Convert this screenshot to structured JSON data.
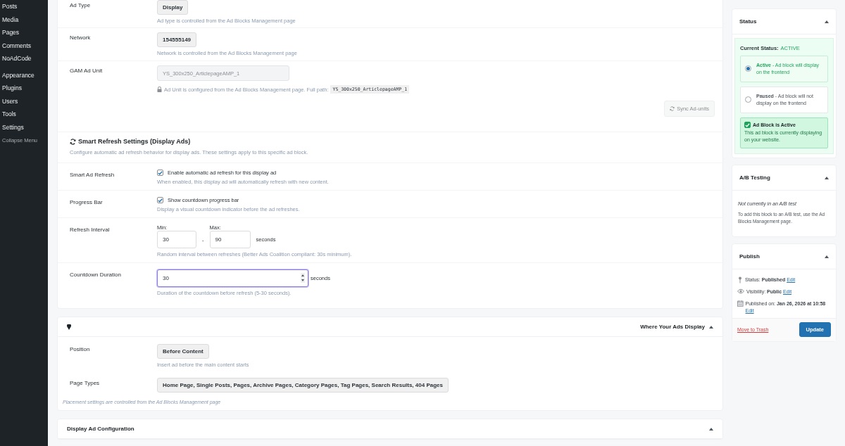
{
  "sidebar": {
    "groups": [
      {
        "items": [
          {
            "label": "Posts"
          },
          {
            "label": "Media"
          },
          {
            "label": "Pages"
          },
          {
            "label": "Comments"
          },
          {
            "label": "NoAdCode"
          }
        ]
      },
      {
        "items": [
          {
            "label": "Appearance"
          },
          {
            "label": "Plugins"
          },
          {
            "label": "Users"
          },
          {
            "label": "Tools"
          },
          {
            "label": "Settings"
          }
        ]
      }
    ],
    "collapse": "Collapse Menu"
  },
  "ad_settings": {
    "rows": [
      {
        "kind": "chip",
        "label": "Ad Type",
        "value": "Display",
        "help": "Ad type is controlled from the Ad Blocks Management page"
      },
      {
        "kind": "chip",
        "label": "Network",
        "value": "154555149",
        "help": "Network is controlled from the Ad Blocks Management page"
      },
      {
        "kind": "locked_input",
        "label": "GAM Ad Unit",
        "value": "YS_300x250_ArticlepageAMP_1",
        "help": "Ad Unit is configured from the Ad Blocks Management page. Full path:",
        "code": "YS_300x250_ArticlepageAMP_1"
      }
    ],
    "sync_button": {
      "label": "Sync Ad-units",
      "disabled": true
    }
  },
  "smart_refresh": {
    "title": "Smart Refresh Settings (Display Ads)",
    "description": "Configure automatic ad refresh behavior for display ads. These settings apply to this specific ad block.",
    "rows": [
      {
        "kind": "checkbox",
        "label": "Smart Ad Refresh",
        "option": "Enable automatic ad refresh for this display ad",
        "checked": true,
        "help": "When enabled, this display ad will automatically refresh with new content."
      },
      {
        "kind": "checkbox",
        "label": "Progress Bar",
        "option": "Show countdown progress bar",
        "checked": true,
        "help": "Display a visual countdown indicator before the ad refreshes."
      },
      {
        "kind": "interval",
        "label": "Refresh Interval",
        "min_label": "Min:",
        "min_value": "30",
        "separator": "-",
        "max_label": "Max:",
        "max_value": "90",
        "unit": "seconds",
        "help": "Random interval between refreshes (Better Ads Coalition compliant: 30s minimum)."
      },
      {
        "kind": "number",
        "label": "Countdown Duration",
        "value": "30",
        "focused": true,
        "unit": "seconds",
        "help": "Duration of the countdown before refresh (5-30 seconds)."
      }
    ]
  },
  "placement": {
    "title": "Where Your Ads Display",
    "expanded": true,
    "rows": [
      {
        "label": "Position",
        "value": "Before Content",
        "help": "Insert ad before the main content starts"
      },
      {
        "label": "Page Types",
        "value": "Home Page, Single Posts, Pages, Archive Pages, Category Pages, Tag Pages, Search Results, 404 Pages"
      }
    ],
    "note": "Placement settings are controlled from the Ad Blocks Management page"
  },
  "display_config": {
    "title": "Display Ad Configuration",
    "expanded": true
  },
  "status_box": {
    "title": "Status",
    "expanded": true,
    "current_label": "Current Status:",
    "current_value": "ACTIVE",
    "options": [
      {
        "title": "Active",
        "description": "- Ad block will display on the frontend",
        "selected": true
      },
      {
        "title": "Paused",
        "description": "- Ad block will not display on the frontend",
        "selected": false
      }
    ],
    "notice": {
      "title": "Ad Block is Active",
      "text": "This ad block is currently displaying on your website.",
      "checked": true
    }
  },
  "ab_testing": {
    "title": "A/B Testing",
    "expanded": true,
    "status": "Not currently in an A/B test",
    "help": "To add this block to an A/B test, use the Ad Blocks Management page."
  },
  "publish": {
    "title": "Publish",
    "expanded": true,
    "items": [
      {
        "kind": "status",
        "label": "Status:",
        "value": "Published",
        "link": "Edit"
      },
      {
        "kind": "visibility",
        "label": "Visibility:",
        "value": "Public",
        "link": "Edit"
      },
      {
        "kind": "date",
        "label": "Published on:",
        "value": "Jan 26, 2026 at 10:58",
        "link": "Edit"
      }
    ],
    "trash": "Move to Trash",
    "update": "Update"
  }
}
